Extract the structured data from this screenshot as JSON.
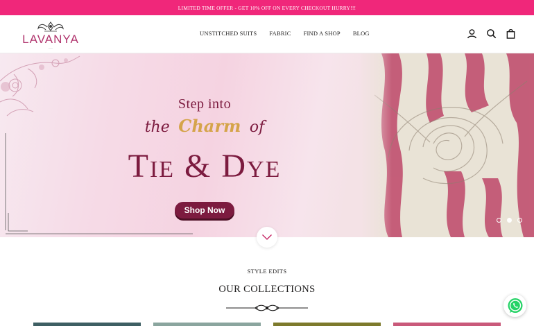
{
  "announcement": "LIMITED TIME OFFER - GET 10% OFF ON EVERY CHECKOUT HURRY!!!",
  "brand": {
    "name": "LAVANYA",
    "color": "#b0346d"
  },
  "nav": [
    {
      "label": "UNSTITCHED SUITS"
    },
    {
      "label": "FABRIC"
    },
    {
      "label": "FIND A SHOP"
    },
    {
      "label": "BLOG"
    }
  ],
  "header_icons": [
    "account-icon",
    "search-icon",
    "cart-icon"
  ],
  "hero": {
    "line1": "Step into",
    "line2_the": "the",
    "line2_charm": "Charm",
    "line2_of": "of",
    "line3": "Tie & Dye",
    "cta": "Shop Now",
    "slides": 3,
    "active_slide": 2
  },
  "section": {
    "eyebrow": "STYLE EDITS",
    "title": "OUR COLLECTIONS"
  },
  "colors": {
    "announcement_bg": "#f0277a",
    "accent": "#7c1b3f",
    "gold": "#d5a44a",
    "whatsapp": "#25d366"
  }
}
